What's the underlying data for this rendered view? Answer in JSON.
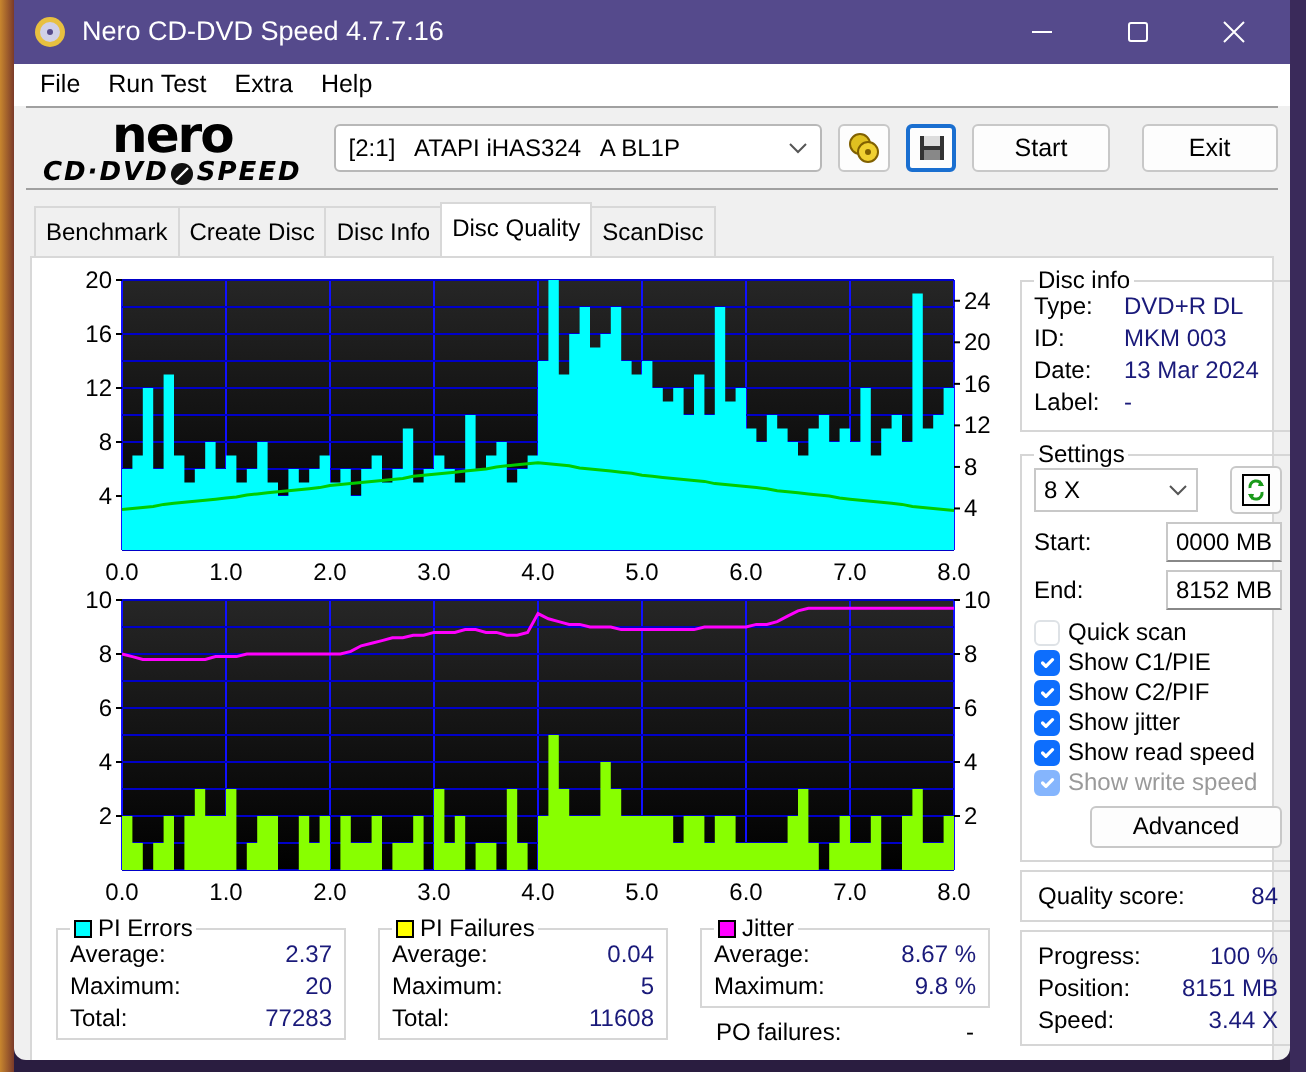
{
  "window": {
    "title": "Nero CD-DVD Speed 4.7.7.16"
  },
  "menu": [
    "File",
    "Run Test",
    "Extra",
    "Help"
  ],
  "logo": {
    "wordmark": "nero",
    "product": [
      "CD·DVD",
      "SPEED"
    ]
  },
  "drive": {
    "value": "[2:1]   ATAPI iHAS324   A BL1P"
  },
  "buttons": [
    "Start",
    "Exit"
  ],
  "tabs": [
    {
      "label": "Benchmark",
      "selected": false
    },
    {
      "label": "Create Disc",
      "selected": false
    },
    {
      "label": "Disc Info",
      "selected": false
    },
    {
      "label": "Disc Quality",
      "selected": true
    },
    {
      "label": "ScanDisc",
      "selected": false
    }
  ],
  "charts": [
    {
      "chart_data": {
        "type": "area",
        "grid": true,
        "xlim": [
          0,
          8
        ],
        "ylim": [
          0,
          20
        ],
        "y2lim": [
          0,
          26
        ],
        "xticks": [
          {
            "value": 0,
            "label": "0.0"
          },
          {
            "value": 1,
            "label": "1.0"
          },
          {
            "value": 2,
            "label": "2.0"
          },
          {
            "value": 3,
            "label": "3.0"
          },
          {
            "value": 4,
            "label": "4.0"
          },
          {
            "value": 5,
            "label": "5.0"
          },
          {
            "value": 6,
            "label": "6.0"
          },
          {
            "value": 7,
            "label": "7.0"
          },
          {
            "value": 8,
            "label": "8.0"
          }
        ],
        "yticks": [
          4,
          8,
          12,
          16,
          20
        ],
        "y2ticks": [
          4,
          8,
          12,
          16,
          20,
          24
        ],
        "x": [
          0,
          0.1,
          0.2,
          0.3,
          0.4,
          0.5,
          0.6,
          0.7,
          0.8,
          0.9,
          1,
          1.1,
          1.2,
          1.3,
          1.4,
          1.5,
          1.6,
          1.7,
          1.8,
          1.9,
          2,
          2.1,
          2.2,
          2.3,
          2.4,
          2.5,
          2.6,
          2.7,
          2.8,
          2.9,
          3,
          3.1,
          3.2,
          3.3,
          3.4,
          3.5,
          3.6,
          3.7,
          3.8,
          3.9,
          4,
          4.1,
          4.2,
          4.3,
          4.4,
          4.5,
          4.6,
          4.7,
          4.8,
          4.9,
          5,
          5.1,
          5.2,
          5.3,
          5.4,
          5.5,
          5.6,
          5.7,
          5.8,
          5.9,
          6,
          6.1,
          6.2,
          6.3,
          6.4,
          6.5,
          6.6,
          6.7,
          6.8,
          6.9,
          7,
          7.1,
          7.2,
          7.3,
          7.4,
          7.5,
          7.6,
          7.7,
          7.8,
          7.9,
          8
        ],
        "series": [
          {
            "color": "#00ffff",
            "values": [
              6,
              7,
              12,
              6,
              13,
              7,
              5,
              6,
              8,
              6,
              7,
              5,
              6,
              8,
              5,
              4,
              6,
              5,
              6,
              7,
              5,
              6,
              4,
              6,
              7,
              5,
              6,
              9,
              5,
              6,
              7,
              6,
              5,
              10,
              6,
              7,
              8,
              5,
              6,
              7,
              14,
              20,
              13,
              16,
              18,
              15,
              16,
              18,
              14,
              13,
              14,
              12,
              11,
              12,
              10,
              13,
              10,
              18,
              11,
              12,
              9,
              8,
              10,
              9,
              8,
              7,
              9,
              10,
              8,
              9,
              8,
              12,
              7,
              9,
              10,
              8,
              19,
              9,
              10,
              12,
              11
            ]
          },
          {
            "color": "#00cc00",
            "type": "line",
            "axis": "y2",
            "values": [
              3.9,
              4.0,
              4.1,
              4.2,
              4.4,
              4.5,
              4.6,
              4.7,
              4.8,
              4.9,
              5.0,
              5.1,
              5.3,
              5.4,
              5.5,
              5.6,
              5.7,
              5.8,
              5.9,
              6.0,
              6.2,
              6.3,
              6.4,
              6.5,
              6.6,
              6.7,
              6.8,
              6.9,
              7.1,
              7.2,
              7.3,
              7.4,
              7.5,
              7.6,
              7.7,
              7.8,
              8.0,
              8.1,
              8.2,
              8.3,
              8.4,
              8.3,
              8.2,
              8.1,
              7.9,
              7.8,
              7.7,
              7.6,
              7.5,
              7.4,
              7.2,
              7.1,
              7.0,
              6.9,
              6.8,
              6.7,
              6.6,
              6.4,
              6.3,
              6.2,
              6.1,
              6.0,
              5.9,
              5.7,
              5.6,
              5.5,
              5.4,
              5.3,
              5.2,
              5.0,
              4.9,
              4.8,
              4.7,
              4.6,
              4.5,
              4.4,
              4.2,
              4.1,
              4.0,
              3.9,
              3.8
            ]
          }
        ]
      }
    },
    {
      "chart_data": {
        "type": "area",
        "grid": true,
        "xlim": [
          0,
          8
        ],
        "ylim": [
          0,
          10
        ],
        "y2lim": [
          0,
          10
        ],
        "xticks": [
          {
            "value": 0,
            "label": "0.0"
          },
          {
            "value": 1,
            "label": "1.0"
          },
          {
            "value": 2,
            "label": "2.0"
          },
          {
            "value": 3,
            "label": "3.0"
          },
          {
            "value": 4,
            "label": "4.0"
          },
          {
            "value": 5,
            "label": "5.0"
          },
          {
            "value": 6,
            "label": "6.0"
          },
          {
            "value": 7,
            "label": "7.0"
          },
          {
            "value": 8,
            "label": "8.0"
          }
        ],
        "yticks": [
          2,
          4,
          6,
          8,
          10
        ],
        "y2ticks": [
          2,
          4,
          6,
          8,
          10
        ],
        "x": [
          0,
          0.1,
          0.2,
          0.3,
          0.4,
          0.5,
          0.6,
          0.7,
          0.8,
          0.9,
          1,
          1.1,
          1.2,
          1.3,
          1.4,
          1.5,
          1.6,
          1.7,
          1.8,
          1.9,
          2,
          2.1,
          2.2,
          2.3,
          2.4,
          2.5,
          2.6,
          2.7,
          2.8,
          2.9,
          3,
          3.1,
          3.2,
          3.3,
          3.4,
          3.5,
          3.6,
          3.7,
          3.8,
          3.9,
          4,
          4.1,
          4.2,
          4.3,
          4.4,
          4.5,
          4.6,
          4.7,
          4.8,
          4.9,
          5,
          5.1,
          5.2,
          5.3,
          5.4,
          5.5,
          5.6,
          5.7,
          5.8,
          5.9,
          6,
          6.1,
          6.2,
          6.3,
          6.4,
          6.5,
          6.6,
          6.7,
          6.8,
          6.9,
          7,
          7.1,
          7.2,
          7.3,
          7.4,
          7.5,
          7.6,
          7.7,
          7.8,
          7.9,
          8
        ],
        "series": [
          {
            "color": "#88ff00",
            "values": [
              2,
              1,
              0,
              1,
              2,
              0,
              2,
              3,
              2,
              2,
              3,
              0,
              1,
              2,
              2,
              0,
              0,
              2,
              1,
              2,
              0,
              2,
              1,
              1,
              2,
              0,
              1,
              1,
              2,
              0,
              3,
              1,
              2,
              0,
              1,
              1,
              0,
              3,
              1,
              0,
              2,
              5,
              3,
              2,
              2,
              2,
              4,
              3,
              2,
              2,
              2,
              2,
              2,
              1,
              2,
              2,
              1,
              2,
              2,
              1,
              1,
              1,
              1,
              1,
              2,
              3,
              1,
              0,
              1,
              2,
              1,
              1,
              2,
              0,
              0,
              2,
              3,
              1,
              1,
              2,
              2
            ]
          },
          {
            "color": "#ff00ff",
            "type": "line",
            "axis": "y2",
            "values": [
              8.0,
              7.9,
              7.8,
              7.8,
              7.8,
              7.8,
              7.8,
              7.8,
              7.8,
              7.9,
              7.9,
              7.9,
              8.0,
              8.0,
              8.0,
              8.0,
              8.0,
              8.0,
              8.0,
              8.0,
              8.0,
              8.0,
              8.1,
              8.3,
              8.4,
              8.5,
              8.6,
              8.6,
              8.7,
              8.7,
              8.8,
              8.8,
              8.8,
              8.9,
              8.9,
              8.8,
              8.8,
              8.7,
              8.7,
              8.8,
              9.5,
              9.3,
              9.2,
              9.1,
              9.1,
              9.0,
              9.0,
              9.0,
              8.9,
              8.9,
              8.9,
              8.9,
              8.9,
              8.9,
              8.9,
              8.9,
              9.0,
              9.0,
              9.0,
              9.0,
              9.0,
              9.1,
              9.1,
              9.2,
              9.4,
              9.6,
              9.7,
              9.7,
              9.7,
              9.7,
              9.7,
              9.7,
              9.7,
              9.7,
              9.7,
              9.7,
              9.7,
              9.7,
              9.7,
              9.7,
              9.7
            ]
          }
        ]
      }
    }
  ],
  "stats": [
    {
      "title": "PI Errors",
      "color": "#00ffff",
      "rows": [
        {
          "label": "Average:",
          "value": "2.37"
        },
        {
          "label": "Maximum:",
          "value": "20"
        },
        {
          "label": "Total:",
          "value": "77283"
        }
      ]
    },
    {
      "title": "PI Failures",
      "color": "#ffff00",
      "rows": [
        {
          "label": "Average:",
          "value": "0.04"
        },
        {
          "label": "Maximum:",
          "value": "5"
        },
        {
          "label": "Total:",
          "value": "11608"
        }
      ]
    },
    {
      "title": "Jitter",
      "color": "#ff00ff",
      "rows": [
        {
          "label": "Average:",
          "value": "8.67 %"
        },
        {
          "label": "Maximum:",
          "value": "9.8 %"
        }
      ]
    }
  ],
  "po_failures": {
    "label": "PO failures:",
    "value": "-"
  },
  "disc_info": {
    "title": "Disc info",
    "rows": [
      {
        "label": "Type:",
        "value": "DVD+R DL"
      },
      {
        "label": "ID:",
        "value": "MKM 003"
      },
      {
        "label": "Date:",
        "value": "13 Mar 2024"
      },
      {
        "label": "Label:",
        "value": "-"
      }
    ]
  },
  "settings": {
    "title": "Settings",
    "speed": "8 X",
    "start": {
      "label": "Start:",
      "value": "0000 MB"
    },
    "end": {
      "label": "End:",
      "value": "8152 MB"
    },
    "options": [
      {
        "label": "Quick scan",
        "checked": false,
        "disabled": false
      },
      {
        "label": "Show C1/PIE",
        "checked": true,
        "disabled": false
      },
      {
        "label": "Show C2/PIF",
        "checked": true,
        "disabled": false
      },
      {
        "label": "Show jitter",
        "checked": true,
        "disabled": false
      },
      {
        "label": "Show read speed",
        "checked": true,
        "disabled": false
      },
      {
        "label": "Show write speed",
        "checked": true,
        "disabled": true
      }
    ],
    "advanced": "Advanced"
  },
  "quality": {
    "label": "Quality score:",
    "value": "84"
  },
  "progress": [
    {
      "label": "Progress:",
      "value": "100 %"
    },
    {
      "label": "Position:",
      "value": "8151 MB"
    },
    {
      "label": "Speed:",
      "value": "3.44 X"
    }
  ]
}
